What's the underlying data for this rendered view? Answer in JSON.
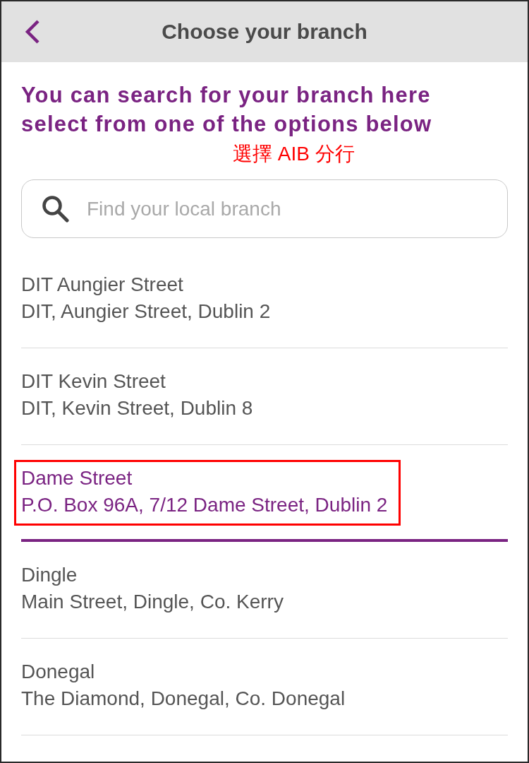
{
  "header": {
    "title": "Choose your branch"
  },
  "intro": "You can search for your branch here\nselect from one of the options below",
  "annotation": "選擇 AIB 分行",
  "search": {
    "placeholder": "Find your local branch"
  },
  "branches": [
    {
      "name": "DIT Aungier Street",
      "address": "DIT, Aungier Street, Dublin 2",
      "selected": false,
      "highlighted": false
    },
    {
      "name": "DIT Kevin Street",
      "address": "DIT, Kevin Street, Dublin 8",
      "selected": false,
      "highlighted": false
    },
    {
      "name": "Dame Street",
      "address": "P.O. Box 96A, 7/12 Dame Street, Dublin 2",
      "selected": true,
      "highlighted": true
    },
    {
      "name": "Dingle",
      "address": "Main Street, Dingle, Co. Kerry",
      "selected": false,
      "highlighted": false
    },
    {
      "name": "Donegal",
      "address": "The Diamond, Donegal, Co. Donegal",
      "selected": false,
      "highlighted": false
    }
  ]
}
